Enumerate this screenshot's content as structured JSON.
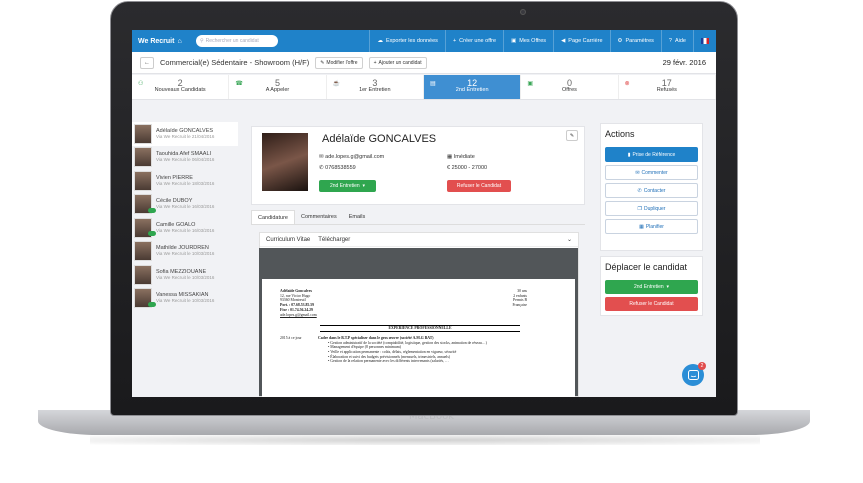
{
  "device": {
    "brand": "MacBook"
  },
  "topnav": {
    "logo": "We Recruit",
    "search_placeholder": "Rechercher un candidat",
    "items": [
      {
        "label": "Exporter les données",
        "icon": "cloud-icon"
      },
      {
        "label": "Créer une offre",
        "icon": "plus-icon"
      },
      {
        "label": "Mes Offres",
        "icon": "briefcase-icon"
      },
      {
        "label": "Page Carrière",
        "icon": "megaphone-icon"
      },
      {
        "label": "Paramètres",
        "icon": "gear-icon"
      },
      {
        "label": "Aide",
        "icon": "help-icon"
      }
    ]
  },
  "subbar": {
    "job_title": "Commercial(e) Sédentaire - Showroom (H/F)",
    "edit_offer": "Modifier l'offre",
    "add_candidate": "Ajouter un candidat",
    "date": "29 févr. 2016"
  },
  "pipeline": [
    {
      "count": "2",
      "label": "Nouveaux Candidats"
    },
    {
      "count": "5",
      "label": "A Appeler"
    },
    {
      "count": "3",
      "label": "1er Entretien"
    },
    {
      "count": "12",
      "label": "2nd Entretien"
    },
    {
      "count": "0",
      "label": "Offres"
    },
    {
      "count": "17",
      "label": "Refusés"
    }
  ],
  "candidates": [
    {
      "name": "Adélaïde GONCALVES",
      "meta": "Via We Recruit le 21/04/2016"
    },
    {
      "name": "Taouhida Afef SMAALI",
      "meta": "Via We Recruit le 06/04/2016"
    },
    {
      "name": "Vivien PIERRE",
      "meta": "Via We Recruit le 18/03/2016"
    },
    {
      "name": "Cécile DUBOY",
      "meta": "Via We Recruit le 16/03/2016"
    },
    {
      "name": "Camille GOALO",
      "meta": "Via We Recruit le 16/03/2016"
    },
    {
      "name": "Mathilde JOURDREN",
      "meta": "Via We Recruit le 10/03/2016"
    },
    {
      "name": "Sofia MEZZIOUANE",
      "meta": "Via We Recruit le 10/03/2016"
    },
    {
      "name": "Vanessa MISSAKIAN",
      "meta": "Via We Recruit le 10/03/2016"
    }
  ],
  "profile": {
    "name": "Adélaïde GONCALVES",
    "email": "ade.lopes.g@gmail.com",
    "phone": "0768538559",
    "availability": "Imédiate",
    "salary": "25000  -  27000",
    "stage_button": "2nd Entretien",
    "reject_button": "Refuser le Candidat"
  },
  "content_tabs": [
    "Candidature",
    "Commentaires",
    "Emails"
  ],
  "cv": {
    "header": "Curriculum Vitae",
    "download": "Télécharger",
    "doc": {
      "name": "Adélaïde Goncalves",
      "address1": "12, rue Victor Hugo",
      "address2": "93360 Montreuil",
      "tel": "Port. : 07.68.53.85.59",
      "fix": "Fixe : 01.74.56.24.29",
      "email": "ade.lopes.g@gmail.com",
      "age": "30 ans",
      "kids": "2 enfants",
      "permit": "Permis B",
      "nationality": "Française",
      "section": "EXPERIENCE PROFESSIONNELLE",
      "year": "2015 à ce jour",
      "job": "Cadre dans le B.T.P spécialiser dans le gros œuvre (société A.M.G BAT)",
      "bullets": [
        "Gestion administratif de la société (comptabilité, logistique, gestion des stocks, animation de réseau…)",
        "Management d'équipe (8 personnes minimum)",
        "Veille et application permanente : coûts, délais, réglementation en vigueur, sécurité",
        "Élaboration et suivi des budgets prévisionnels (mensuels, trimestriels, annuels)",
        "Gestion de la relation permanente avec les différents intervenants (salariés, …"
      ]
    }
  },
  "actions": {
    "title": "Actions",
    "items": [
      {
        "label": "Prise de Référence",
        "icon": "bookmark-icon"
      },
      {
        "label": "Commenter",
        "icon": "comment-icon"
      },
      {
        "label": "Contacter",
        "icon": "phone-icon"
      },
      {
        "label": "Dupliquer",
        "icon": "copy-icon"
      },
      {
        "label": "Planifier",
        "icon": "calendar-icon"
      }
    ]
  },
  "move": {
    "title": "Déplacer le candidat",
    "stage": "2nd Entretien",
    "reject": "Refuser le Candidat"
  },
  "chat": {
    "badge": "2"
  },
  "colors": {
    "primary": "#1f82c9",
    "success": "#2fa64f",
    "danger": "#e24f4f"
  }
}
